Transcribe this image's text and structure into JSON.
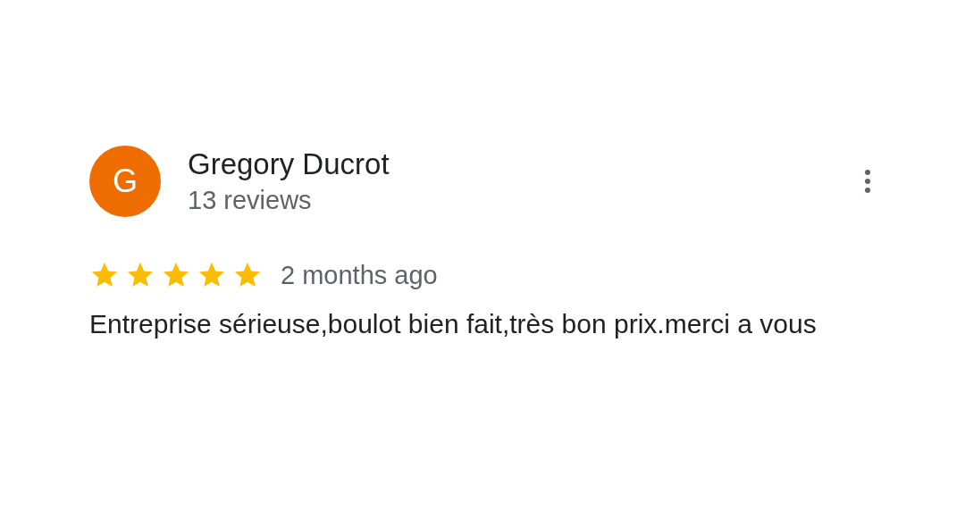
{
  "review": {
    "avatar_letter": "G",
    "author": "Gregory Ducrot",
    "author_meta": "13 reviews",
    "stars": 5,
    "time": "2 months ago",
    "text": "Entreprise sérieuse,boulot bien fait,très bon prix.merci a vous"
  }
}
